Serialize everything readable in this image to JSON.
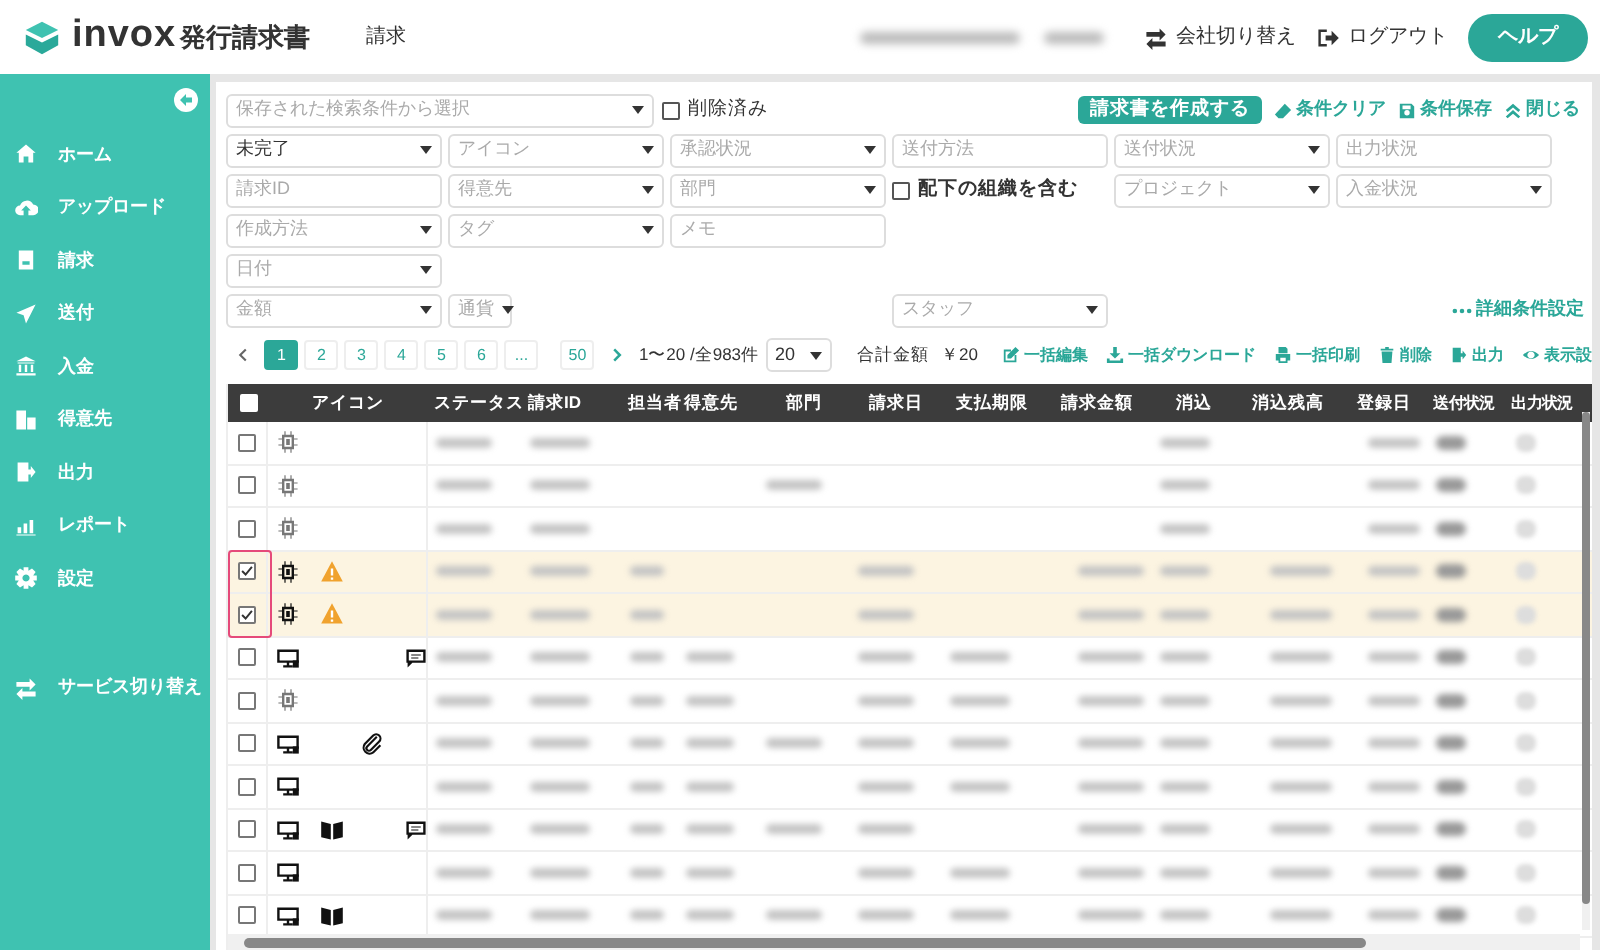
{
  "header": {
    "logo": "invox",
    "product": "発行請求書",
    "page": "請求",
    "actions": [
      {
        "label": "会社切り替え"
      },
      {
        "label": "ログアウト"
      }
    ],
    "help": "ヘルプ"
  },
  "sidebar": {
    "items": [
      {
        "label": "ホーム"
      },
      {
        "label": "アップロード"
      },
      {
        "label": "請求"
      },
      {
        "label": "送付"
      },
      {
        "label": "入金"
      },
      {
        "label": "得意先"
      },
      {
        "label": "出力"
      },
      {
        "label": "レポート"
      },
      {
        "label": "設定"
      }
    ],
    "footer": {
      "label": "サービス切り替え"
    }
  },
  "filters": {
    "saved_search": {
      "placeholder": "保存された検索条件から選択"
    },
    "deleted": {
      "label": "削除済み",
      "checked": false
    },
    "create_button": "請求書を作成する",
    "actions": [
      {
        "label": "条件クリア"
      },
      {
        "label": "条件保存"
      },
      {
        "label": "閉じる"
      }
    ],
    "rows": [
      [
        {
          "kind": "select",
          "value": "未完了"
        },
        {
          "kind": "select",
          "placeholder": "アイコン"
        },
        {
          "kind": "select",
          "placeholder": "承認状況"
        },
        {
          "kind": "input",
          "placeholder": "送付方法"
        },
        {
          "kind": "select",
          "placeholder": "送付状況"
        },
        {
          "kind": "input",
          "placeholder": "出力状況"
        }
      ],
      [
        {
          "kind": "input",
          "placeholder": "請求ID"
        },
        {
          "kind": "select",
          "placeholder": "得意先"
        },
        {
          "kind": "select",
          "placeholder": "部門"
        },
        {
          "kind": "checkbox",
          "label": "配下の組織を含む",
          "checked": false
        },
        {
          "kind": "select",
          "placeholder": "プロジェクト"
        },
        {
          "kind": "select",
          "placeholder": "入金状況"
        }
      ],
      [
        {
          "kind": "select",
          "placeholder": "作成方法"
        },
        {
          "kind": "select",
          "placeholder": "タグ"
        },
        {
          "kind": "input",
          "placeholder": "メモ"
        }
      ],
      [
        {
          "kind": "select",
          "placeholder": "日付"
        }
      ]
    ],
    "amount": {
      "placeholder": "金額"
    },
    "currency": {
      "placeholder": "通貨"
    },
    "staff": {
      "placeholder": "スタッフ"
    },
    "advanced": "詳細条件設定"
  },
  "pagination": {
    "pages": [
      {
        "label": "1",
        "selected": true
      },
      {
        "label": "2",
        "selected": false
      },
      {
        "label": "3",
        "selected": false
      },
      {
        "label": "4",
        "selected": false
      },
      {
        "label": "5",
        "selected": false
      },
      {
        "label": "6",
        "selected": false
      },
      {
        "label": "...",
        "selected": false
      },
      {
        "label": "50",
        "selected": false
      }
    ],
    "range": "1〜20 /全983件",
    "per_page": "20",
    "total_label": "合計金額",
    "total": "￥20"
  },
  "toolbar": [
    {
      "label": "一括編集"
    },
    {
      "label": "一括ダウンロード"
    },
    {
      "label": "一括印刷"
    },
    {
      "label": "削除"
    },
    {
      "label": "出力"
    },
    {
      "label": "表示設"
    }
  ],
  "table": {
    "all_checked": false,
    "columns": [
      "アイコン",
      "ステータス",
      "請求ID",
      "担当者",
      "得意先",
      "部門",
      "請求日",
      "支払期限",
      "請求金額",
      "消込",
      "消込残高",
      "登録日",
      "送付状況",
      "出力状況"
    ],
    "rows": [
      {
        "checked": false,
        "highlighted": false,
        "icons": [
          {
            "kind": "chip"
          }
        ],
        "cells": [
          {
            "kind": "blurred"
          },
          {
            "kind": "blurred"
          },
          {
            "kind": "empty"
          },
          {
            "kind": "empty"
          },
          {
            "kind": "empty"
          },
          {
            "kind": "empty"
          },
          {
            "kind": "empty"
          },
          {
            "kind": "empty"
          },
          {
            "kind": "blurred"
          },
          {
            "kind": "empty"
          },
          {
            "kind": "blurred"
          }
        ]
      },
      {
        "checked": false,
        "highlighted": false,
        "icons": [
          {
            "kind": "chip"
          }
        ],
        "cells": [
          {
            "kind": "blurred"
          },
          {
            "kind": "blurred"
          },
          {
            "kind": "empty"
          },
          {
            "kind": "empty"
          },
          {
            "kind": "blurred"
          },
          {
            "kind": "empty"
          },
          {
            "kind": "empty"
          },
          {
            "kind": "empty"
          },
          {
            "kind": "blurred"
          },
          {
            "kind": "empty"
          },
          {
            "kind": "blurred"
          }
        ]
      },
      {
        "checked": false,
        "highlighted": false,
        "icons": [
          {
            "kind": "chip"
          }
        ],
        "cells": [
          {
            "kind": "blurred"
          },
          {
            "kind": "blurred"
          },
          {
            "kind": "empty"
          },
          {
            "kind": "empty"
          },
          {
            "kind": "empty"
          },
          {
            "kind": "empty"
          },
          {
            "kind": "empty"
          },
          {
            "kind": "empty"
          },
          {
            "kind": "blurred"
          },
          {
            "kind": "empty"
          },
          {
            "kind": "blurred"
          }
        ]
      },
      {
        "checked": true,
        "highlighted": true,
        "icons": [
          {
            "kind": "chip"
          },
          {
            "kind": "warning"
          }
        ],
        "cells": [
          {
            "kind": "blurred"
          },
          {
            "kind": "blurred"
          },
          {
            "kind": "blurred"
          },
          {
            "kind": "empty"
          },
          {
            "kind": "empty"
          },
          {
            "kind": "blurred"
          },
          {
            "kind": "empty"
          },
          {
            "kind": "blurred"
          },
          {
            "kind": "blurred"
          },
          {
            "kind": "blurred"
          },
          {
            "kind": "blurred"
          }
        ]
      },
      {
        "checked": true,
        "highlighted": true,
        "icons": [
          {
            "kind": "chip"
          },
          {
            "kind": "warning"
          }
        ],
        "cells": [
          {
            "kind": "blurred"
          },
          {
            "kind": "blurred"
          },
          {
            "kind": "blurred"
          },
          {
            "kind": "empty"
          },
          {
            "kind": "empty"
          },
          {
            "kind": "blurred"
          },
          {
            "kind": "empty"
          },
          {
            "kind": "blurred"
          },
          {
            "kind": "blurred"
          },
          {
            "kind": "blurred"
          },
          {
            "kind": "blurred"
          }
        ]
      },
      {
        "checked": false,
        "highlighted": false,
        "icons": [
          {
            "kind": "monitor"
          },
          {
            "kind": "comment"
          }
        ],
        "cells": [
          {
            "kind": "blurred"
          },
          {
            "kind": "blurred"
          },
          {
            "kind": "blurred"
          },
          {
            "kind": "blurred"
          },
          {
            "kind": "empty"
          },
          {
            "kind": "blurred"
          },
          {
            "kind": "blurred"
          },
          {
            "kind": "blurred"
          },
          {
            "kind": "blurred"
          },
          {
            "kind": "blurred"
          },
          {
            "kind": "blurred"
          }
        ]
      },
      {
        "checked": false,
        "highlighted": false,
        "icons": [
          {
            "kind": "chip"
          }
        ],
        "cells": [
          {
            "kind": "blurred"
          },
          {
            "kind": "blurred"
          },
          {
            "kind": "blurred"
          },
          {
            "kind": "blurred"
          },
          {
            "kind": "empty"
          },
          {
            "kind": "blurred"
          },
          {
            "kind": "blurred"
          },
          {
            "kind": "blurred"
          },
          {
            "kind": "blurred"
          },
          {
            "kind": "blurred"
          },
          {
            "kind": "blurred"
          }
        ]
      },
      {
        "checked": false,
        "highlighted": false,
        "icons": [
          {
            "kind": "monitor"
          },
          {
            "kind": "clip"
          }
        ],
        "cells": [
          {
            "kind": "blurred"
          },
          {
            "kind": "blurred"
          },
          {
            "kind": "blurred"
          },
          {
            "kind": "blurred"
          },
          {
            "kind": "blurred"
          },
          {
            "kind": "blurred"
          },
          {
            "kind": "blurred"
          },
          {
            "kind": "blurred"
          },
          {
            "kind": "blurred"
          },
          {
            "kind": "blurred"
          },
          {
            "kind": "blurred"
          }
        ]
      },
      {
        "checked": false,
        "highlighted": false,
        "icons": [
          {
            "kind": "monitor"
          }
        ],
        "cells": [
          {
            "kind": "blurred"
          },
          {
            "kind": "blurred"
          },
          {
            "kind": "blurred"
          },
          {
            "kind": "blurred"
          },
          {
            "kind": "empty"
          },
          {
            "kind": "blurred"
          },
          {
            "kind": "blurred"
          },
          {
            "kind": "blurred"
          },
          {
            "kind": "blurred"
          },
          {
            "kind": "blurred"
          },
          {
            "kind": "blurred"
          }
        ]
      },
      {
        "checked": false,
        "highlighted": false,
        "icons": [
          {
            "kind": "monitor"
          },
          {
            "kind": "book"
          },
          {
            "kind": "comment"
          }
        ],
        "cells": [
          {
            "kind": "blurred"
          },
          {
            "kind": "blurred"
          },
          {
            "kind": "blurred"
          },
          {
            "kind": "blurred"
          },
          {
            "kind": "blurred"
          },
          {
            "kind": "blurred"
          },
          {
            "kind": "empty"
          },
          {
            "kind": "blurred"
          },
          {
            "kind": "blurred"
          },
          {
            "kind": "blurred"
          },
          {
            "kind": "blurred"
          }
        ]
      },
      {
        "checked": false,
        "highlighted": false,
        "icons": [
          {
            "kind": "monitor"
          }
        ],
        "cells": [
          {
            "kind": "blurred"
          },
          {
            "kind": "blurred"
          },
          {
            "kind": "blurred"
          },
          {
            "kind": "blurred"
          },
          {
            "kind": "empty"
          },
          {
            "kind": "blurred"
          },
          {
            "kind": "blurred"
          },
          {
            "kind": "blurred"
          },
          {
            "kind": "blurred"
          },
          {
            "kind": "blurred"
          },
          {
            "kind": "blurred"
          }
        ]
      },
      {
        "checked": false,
        "highlighted": false,
        "icons": [
          {
            "kind": "monitor"
          },
          {
            "kind": "book"
          }
        ],
        "cells": [
          {
            "kind": "blurred"
          },
          {
            "kind": "blurred"
          },
          {
            "kind": "blurred"
          },
          {
            "kind": "blurred"
          },
          {
            "kind": "blurred"
          },
          {
            "kind": "blurred"
          },
          {
            "kind": "blurred"
          },
          {
            "kind": "blurred"
          },
          {
            "kind": "blurred"
          },
          {
            "kind": "blurred"
          },
          {
            "kind": "blurred"
          }
        ]
      }
    ]
  }
}
